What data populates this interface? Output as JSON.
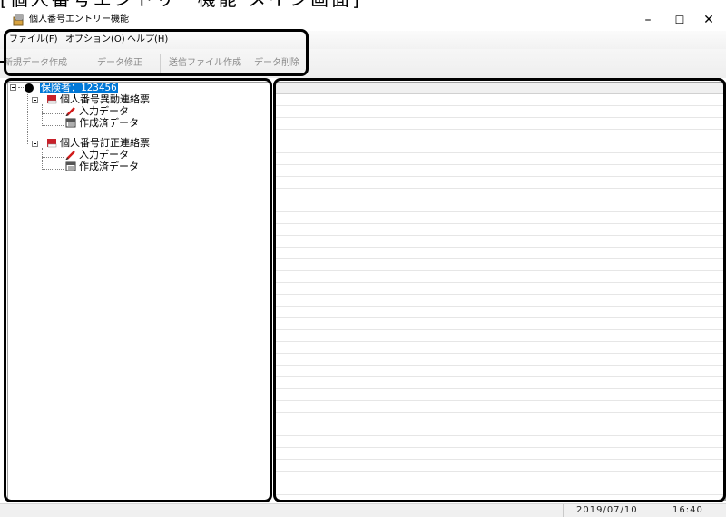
{
  "document_caption": "[個人番号エントリー機能 メイン画面]",
  "window": {
    "title": "個人番号エントリー機能",
    "minimize_glyph": "–",
    "maximize_glyph": "☐",
    "close_glyph": "✕"
  },
  "menu": {
    "items": [
      "ファイル(F)",
      "オプション(O)",
      "ヘルプ(H)"
    ]
  },
  "toolbar": {
    "buttons": [
      "新規データ作成",
      "データ修正",
      "送信ファイル作成",
      "データ削除"
    ]
  },
  "tree": {
    "root": "保険者：123456",
    "groups": [
      {
        "label": "個人番号異動連絡票",
        "children": [
          "入力データ",
          "作成済データ"
        ]
      },
      {
        "label": "個人番号訂正連絡票",
        "children": [
          "入力データ",
          "作成済データ"
        ]
      }
    ]
  },
  "status": {
    "date": "2019/07/10",
    "time": "16:40"
  },
  "colors": {
    "selection": "#0078d7",
    "callout_border": "#000000"
  },
  "icons": {
    "app": "app-icon",
    "group": "book-icon",
    "input": "pencil-icon",
    "created": "document-icon"
  }
}
